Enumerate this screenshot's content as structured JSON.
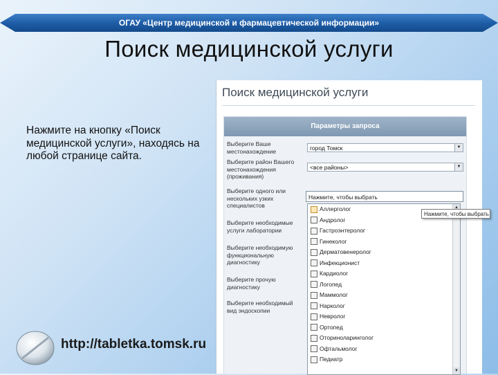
{
  "banner": {
    "text": "ОГАУ «Центр медицинской и фармацевтической информации»"
  },
  "slide": {
    "title": "Поиск медицинской услуги",
    "instruction": "Нажмите на кнопку «Поиск медицинской услуги», находясь на любой странице сайта.",
    "url": "http://tabletka.tomsk.ru"
  },
  "screenshot": {
    "title": "Поиск медицинской услуги",
    "form_header": "Параметры запроса",
    "fields": {
      "location_label": "Выберите Ваше местонахождение",
      "location_value": "город Томск",
      "district_label": "Выберите район Вашего местонахождения (проживания)",
      "district_value": "<все районы>",
      "specialists_label": "Выберите одного или нескольких узких специалистов",
      "specialists_placeholder": "Нажмите, чтобы выбрать",
      "lab_label": "Выберите необходимые услуги лаборатории",
      "functional_label": "Выберите необходимую функциональную диагностику",
      "other_label": "Выберите прочую диагностику",
      "endoscopy_label": "Выберите необходимый вид эндоскопии"
    },
    "tooltip": "Нажмите, чтобы выбрать",
    "specialists": [
      "Аллерголог",
      "Андролог",
      "Гастроэнтеролог",
      "Гинеколог",
      "Дерматовенеролог",
      "Инфекционист",
      "Кардиолог",
      "Логопед",
      "Маммолог",
      "Нарколог",
      "Невролог",
      "Ортопед",
      "Оториноларинголог",
      "Офтальмолог",
      "Педиатр"
    ]
  }
}
